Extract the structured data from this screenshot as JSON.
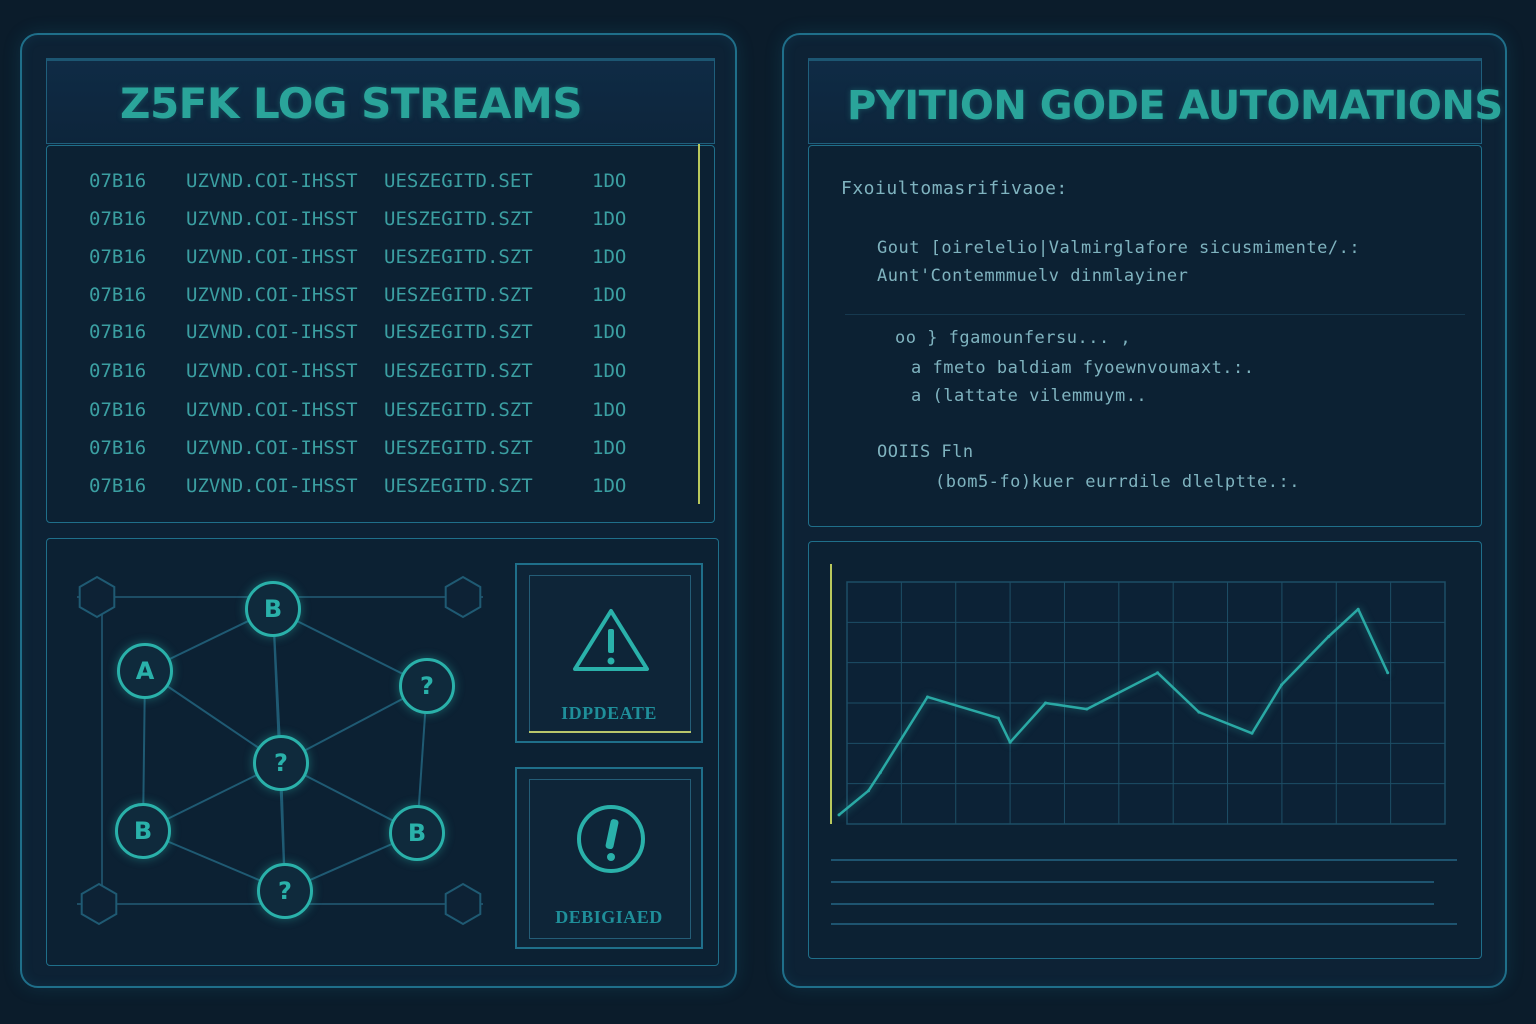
{
  "left": {
    "title": "Z5FK LOG STREAMS",
    "log_rows": [
      [
        "07B16",
        "UZVND.COI-IHSST",
        "UESZEGITD.SET",
        "1DO"
      ],
      [
        "07B16",
        "UZVND.COI-IHSST",
        "UESZEGITD.SZT",
        "1DO"
      ],
      [
        "07B16",
        "UZVND.COI-IHSST",
        "UESZEGITD.SZT",
        "1DO"
      ],
      [
        "07B16",
        "UZVND.COI-IHSST",
        "UESZEGITD.SZT",
        "1DO"
      ],
      [
        "07B16",
        "UZVND.COI-IHSST",
        "UESZEGITD.SZT",
        "1DO"
      ],
      [
        "07B16",
        "UZVND.COI-IHSST",
        "UESZEGITD.SZT",
        "1DO"
      ],
      [
        "07B16",
        "UZVND.COI-IHSST",
        "UESZEGITD.SZT",
        "1DO"
      ],
      [
        "07B16",
        "UZVND.COI-IHSST",
        "UESZEGITD.SZT",
        "1DO"
      ],
      [
        "07B16",
        "UZVND.COI-IHSST",
        "UESZEGITD.SZT",
        "1DO"
      ]
    ],
    "alerts": [
      {
        "label": "IDPDEATE",
        "icon": "warning-triangle-icon"
      },
      {
        "label": "DEBIGIAED",
        "icon": "exclamation-circle-icon"
      }
    ],
    "nodes": [
      "B",
      "A",
      "?",
      "?",
      "B",
      "B",
      "?"
    ]
  },
  "right": {
    "title": "PYITION GODE AUTOMATIONS",
    "code_lines": [
      "Fxoiultomasrifivaoe:",
      "Gout [oirelelio|Valmirglafore sicusmimente/.:",
      "Aunt'Contemmmuelv dinmlayiner",
      "oo }  fgamounfersu... ,",
      "a  fmeto baldiam fyoewnvoumaxt.:.",
      "a  (lattate vilemmuym..",
      "OOIIS  Fln",
      "(bom5-fo)kuer eurrdile dlelptte.:."
    ]
  },
  "chart_data": {
    "type": "line",
    "title": "",
    "xlabel": "",
    "ylabel": "",
    "x": [
      0,
      1,
      2,
      3,
      4,
      5,
      6,
      7,
      8,
      9,
      10,
      11,
      12,
      13,
      14,
      15,
      16,
      17
    ],
    "series": [
      {
        "values": [
          3,
          11,
          17,
          42,
          35,
          27,
          40,
          38,
          50,
          37,
          30,
          46,
          62,
          71,
          50
        ]
      }
    ],
    "grid": true,
    "colors": {
      "line": "#2aa9a5",
      "grid": "#1d4e66"
    }
  }
}
